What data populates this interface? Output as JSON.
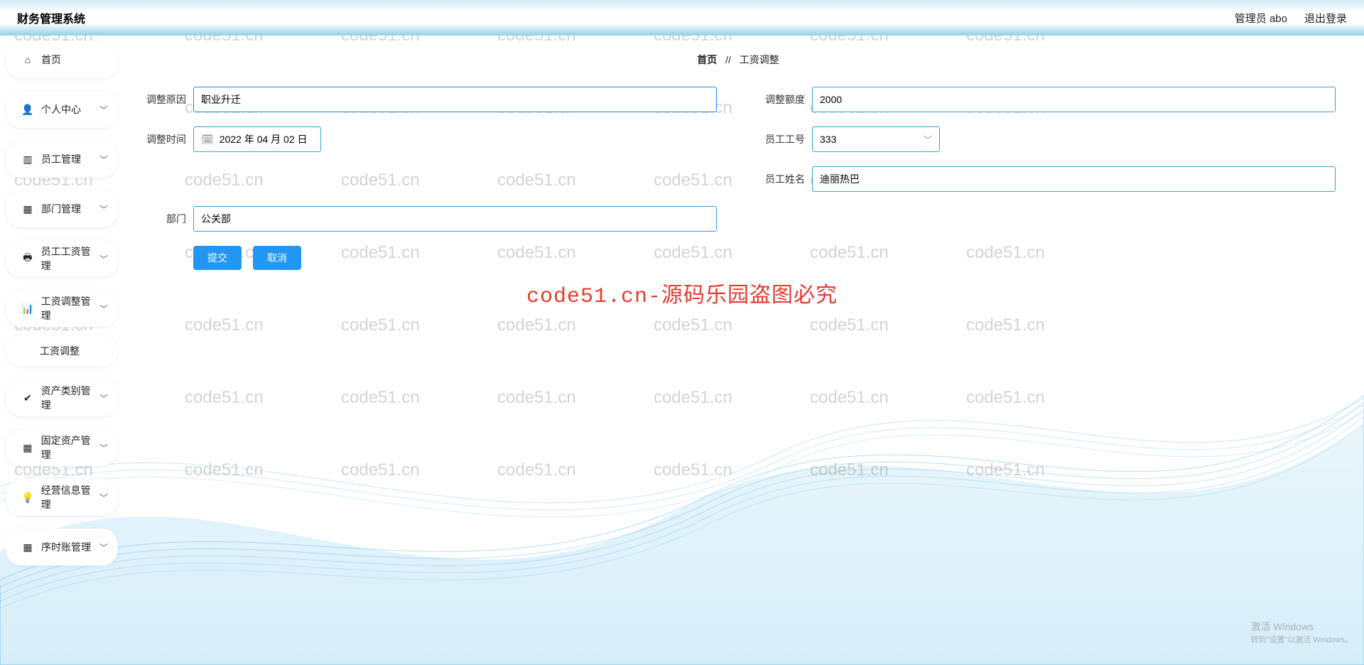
{
  "header": {
    "title": "财务管理系统",
    "admin_label": "管理员 abo",
    "logout_label": "退出登录"
  },
  "sidebar": {
    "items": [
      {
        "icon": "home-icon",
        "glyph": "⌂",
        "label": "首页",
        "expandable": false
      },
      {
        "icon": "user-icon",
        "glyph": "👤",
        "label": "个人中心",
        "expandable": true
      },
      {
        "icon": "employee-icon",
        "glyph": "▥",
        "label": "员工管理",
        "expandable": true
      },
      {
        "icon": "dept-icon",
        "glyph": "▦",
        "label": "部门管理",
        "expandable": true
      },
      {
        "icon": "salary-icon",
        "glyph": "🖶",
        "label": "员工工资管理",
        "expandable": true
      },
      {
        "icon": "adjust-icon",
        "glyph": "📊",
        "label": "工资调整管理",
        "expandable": true
      },
      {
        "icon": "asset-cat-icon",
        "glyph": "✔",
        "label": "资产类别管理",
        "expandable": true
      },
      {
        "icon": "fixed-asset-icon",
        "glyph": "▦",
        "label": "固定资产管理",
        "expandable": true
      },
      {
        "icon": "biz-info-icon",
        "glyph": "💡",
        "label": "经营信息管理",
        "expandable": true
      },
      {
        "icon": "ledger-icon",
        "glyph": "▦",
        "label": "序时账管理",
        "expandable": true
      }
    ],
    "sub_item": "工资调整"
  },
  "breadcrumb": {
    "home": "首页",
    "sep": "//",
    "current": "工资调整"
  },
  "form": {
    "reason_label": "调整原因",
    "reason_value": "职业升迁",
    "amount_label": "调整额度",
    "amount_value": "2000",
    "time_label": "调整时间",
    "time_value": "2022 年 04 月 02 日",
    "empid_label": "员工工号",
    "empid_value": "333",
    "empname_label": "员工姓名",
    "empname_value": "迪丽热巴",
    "dept_label": "部门",
    "dept_value": "公关部",
    "submit": "提交",
    "cancel": "取消"
  },
  "watermark": {
    "text": "code51.cn",
    "center": "code51.cn-源码乐园盗图必究"
  },
  "win_activate": {
    "line1": "激活 Windows",
    "line2": "转到\"设置\"以激活 Windows。"
  }
}
